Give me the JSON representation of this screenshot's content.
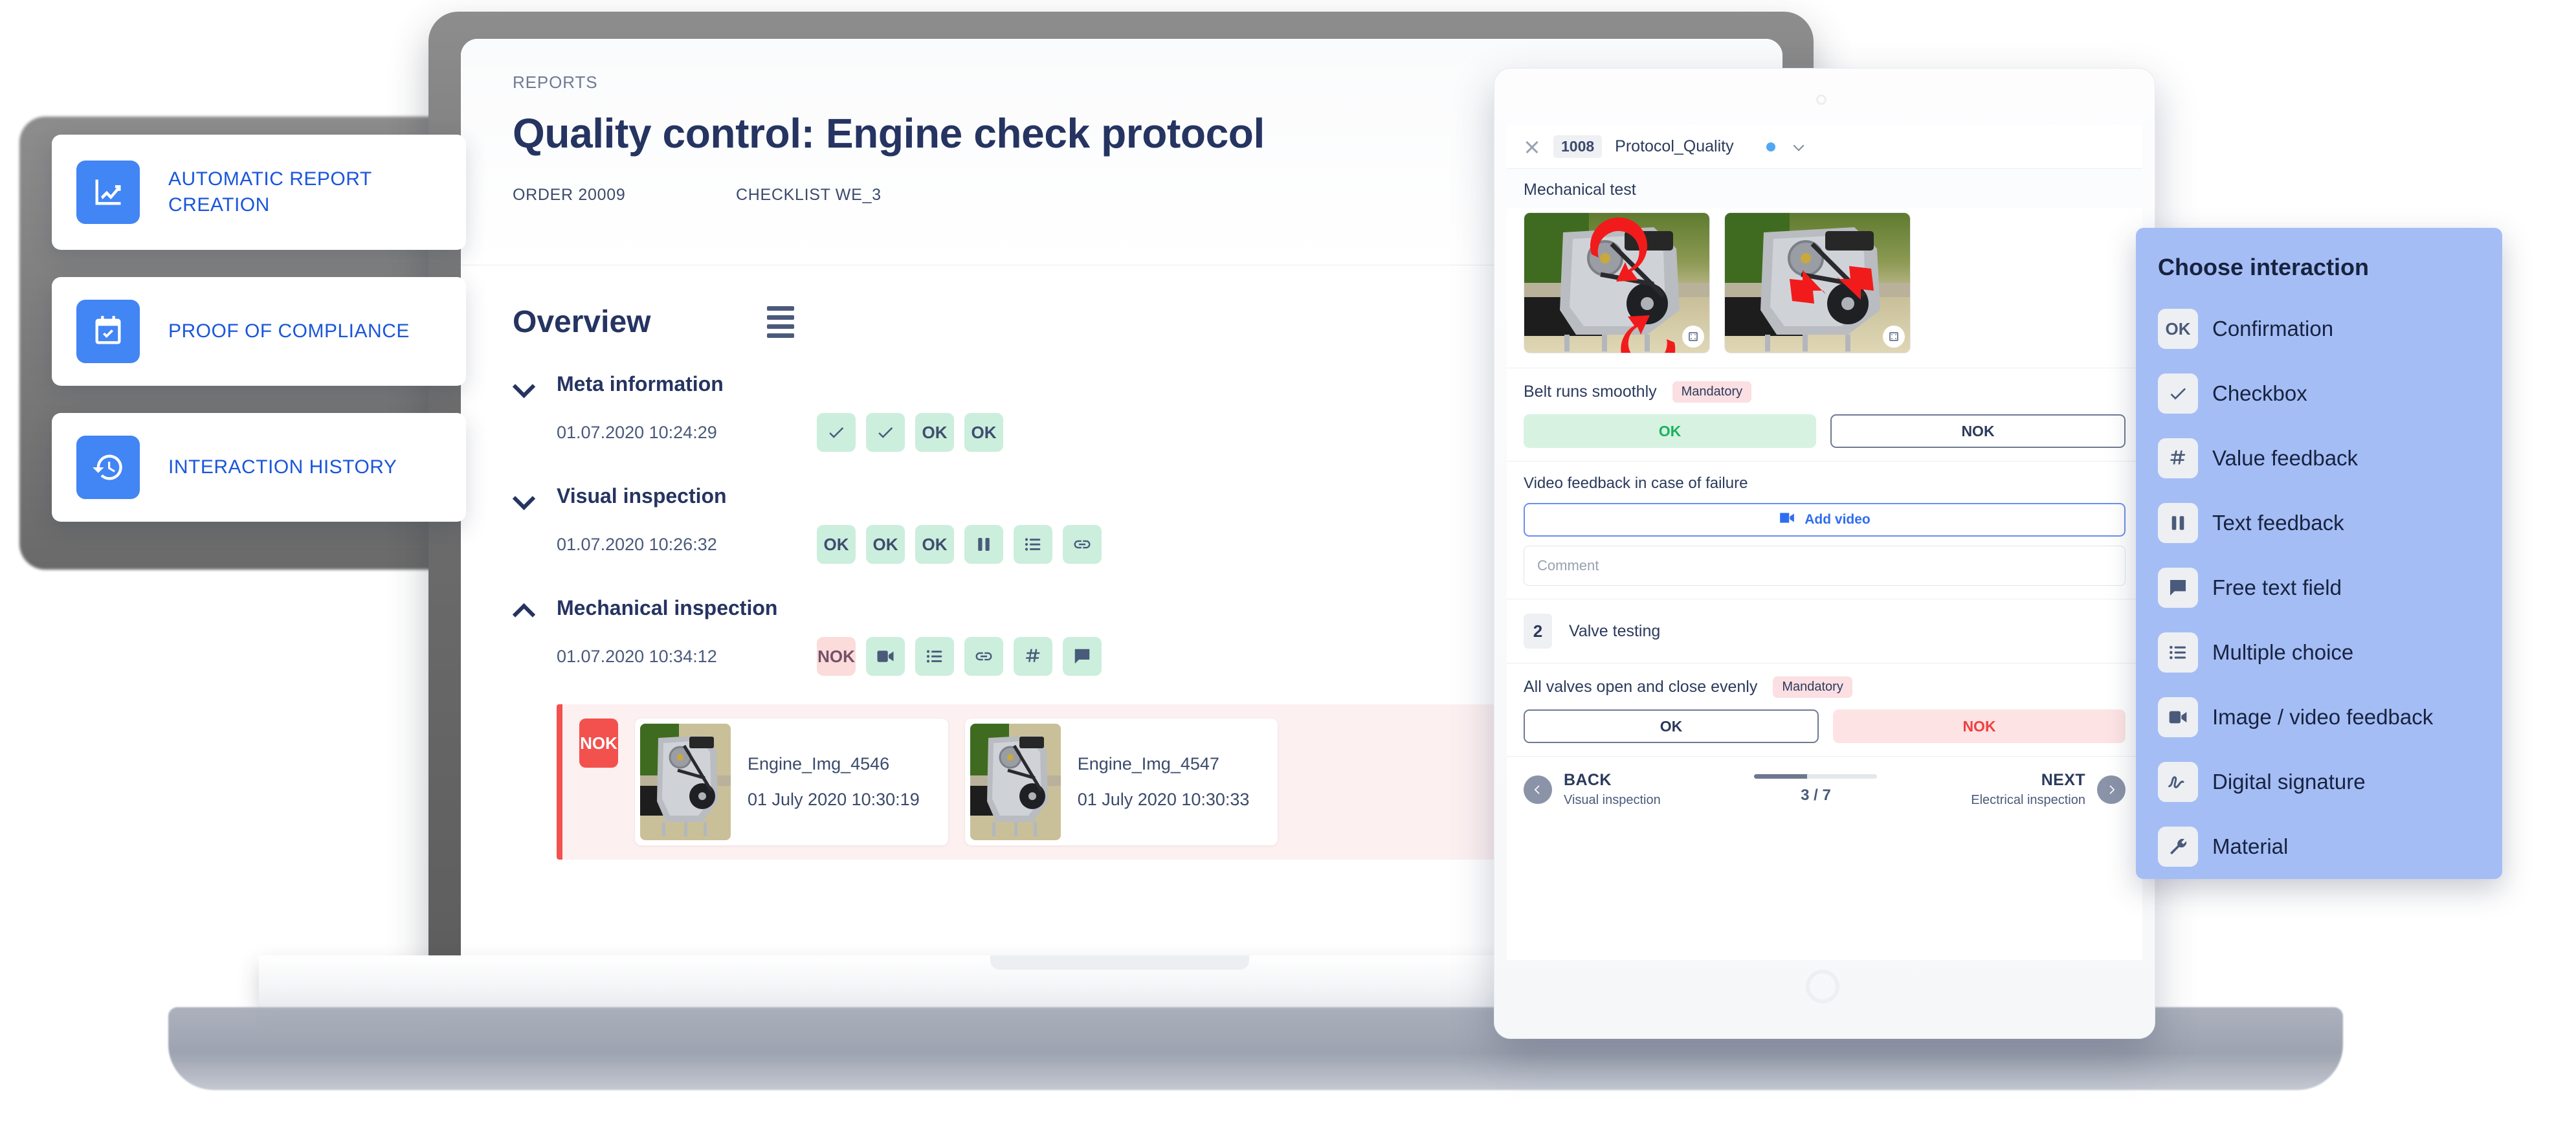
{
  "features": [
    {
      "label": "AUTOMATIC REPORT CREATION",
      "icon": "chart-line-icon"
    },
    {
      "label": "PROOF OF COMPLIANCE",
      "icon": "calendar-check-icon"
    },
    {
      "label": "INTERACTION HISTORY",
      "icon": "history-clock-icon"
    }
  ],
  "report": {
    "kicker": "REPORTS",
    "title": "Quality control: Engine check protocol",
    "order": "ORDER 20009",
    "checklist": "CHECKLIST WE_3",
    "overview_title": "Overview",
    "sections": [
      {
        "name": "Meta information",
        "timestamp": "01.07.2020 10:24:29",
        "expanded": false,
        "badges": [
          {
            "type": "check",
            "text": "",
            "status": "ok"
          },
          {
            "type": "check",
            "text": "",
            "status": "ok"
          },
          {
            "type": "text",
            "text": "OK",
            "status": "ok"
          },
          {
            "type": "text",
            "text": "OK",
            "status": "ok"
          }
        ]
      },
      {
        "name": "Visual inspection",
        "timestamp": "01.07.2020 10:26:32",
        "expanded": false,
        "badges": [
          {
            "type": "text",
            "text": "OK",
            "status": "ok"
          },
          {
            "type": "text",
            "text": "OK",
            "status": "ok"
          },
          {
            "type": "text",
            "text": "OK",
            "status": "ok"
          },
          {
            "type": "pause",
            "text": "",
            "status": "ok"
          },
          {
            "type": "list",
            "text": "",
            "status": "ok"
          },
          {
            "type": "link",
            "text": "",
            "status": "ok"
          }
        ]
      },
      {
        "name": "Mechanical inspection",
        "timestamp": "01.07.2020 10:34:12",
        "expanded": true,
        "badges": [
          {
            "type": "text",
            "text": "NOK",
            "status": "nok"
          },
          {
            "type": "video",
            "text": "",
            "status": "ok"
          },
          {
            "type": "list",
            "text": "",
            "status": "ok"
          },
          {
            "type": "link",
            "text": "",
            "status": "ok"
          },
          {
            "type": "hash",
            "text": "#",
            "status": "ok"
          },
          {
            "type": "comment",
            "text": "",
            "status": "ok"
          }
        ]
      }
    ],
    "nok_panel": {
      "tag": "NOK",
      "images": [
        {
          "name": "Engine_Img_4546",
          "date": "01 July 2020 10:30:19"
        },
        {
          "name": "Engine_Img_4547",
          "date": "01 July 2020 10:30:33"
        }
      ]
    }
  },
  "tablet": {
    "topbar": {
      "close": "close-icon",
      "number": "1008",
      "name": "Protocol_Quality"
    },
    "section_title": "Mechanical test",
    "images": [
      {
        "alt": "engine-with-rotation-arrows"
      },
      {
        "alt": "engine-with-direction-arrows"
      }
    ],
    "question1": {
      "label": "Belt runs smoothly",
      "pill": "Mandatory",
      "ok": "OK",
      "nok": "NOK",
      "selected": "OK"
    },
    "video_feedback": {
      "label": "Video feedback in case of failure",
      "add_video": "Add video",
      "comment_placeholder": "Comment"
    },
    "step2": {
      "number": "2",
      "name": "Valve testing"
    },
    "question2": {
      "label": "All valves open and close evenly",
      "pill": "Mandatory",
      "ok": "OK",
      "nok": "NOK",
      "selected": "NOK"
    },
    "nav": {
      "back_label": "BACK",
      "back_sub": "Visual inspection",
      "next_label": "NEXT",
      "next_sub": "Electrical inspection",
      "progress": "3 / 7",
      "progress_pct": "43%"
    }
  },
  "interaction_panel": {
    "title": "Choose interaction",
    "items": [
      {
        "label": "Confirmation",
        "icon": "ok-icon"
      },
      {
        "label": "Checkbox",
        "icon": "check-icon"
      },
      {
        "label": "Value feedback",
        "icon": "hash-icon"
      },
      {
        "label": "Text feedback",
        "icon": "pause-bars-icon"
      },
      {
        "label": "Free text field",
        "icon": "comment-icon"
      },
      {
        "label": "Multiple choice",
        "icon": "list-icon"
      },
      {
        "label": "Image / video feedback",
        "icon": "video-icon"
      },
      {
        "label": "Digital signature",
        "icon": "signature-icon"
      },
      {
        "label": "Material",
        "icon": "wrench-icon"
      }
    ]
  },
  "colors": {
    "brand_blue": "#4285f4",
    "link_blue": "#1a56db",
    "navy": "#253461",
    "ok_green_bg": "#cceedd",
    "nok_red_bg": "#fbdcda",
    "nok_red": "#f2514e",
    "panel_blue": "#a5bdf5"
  }
}
